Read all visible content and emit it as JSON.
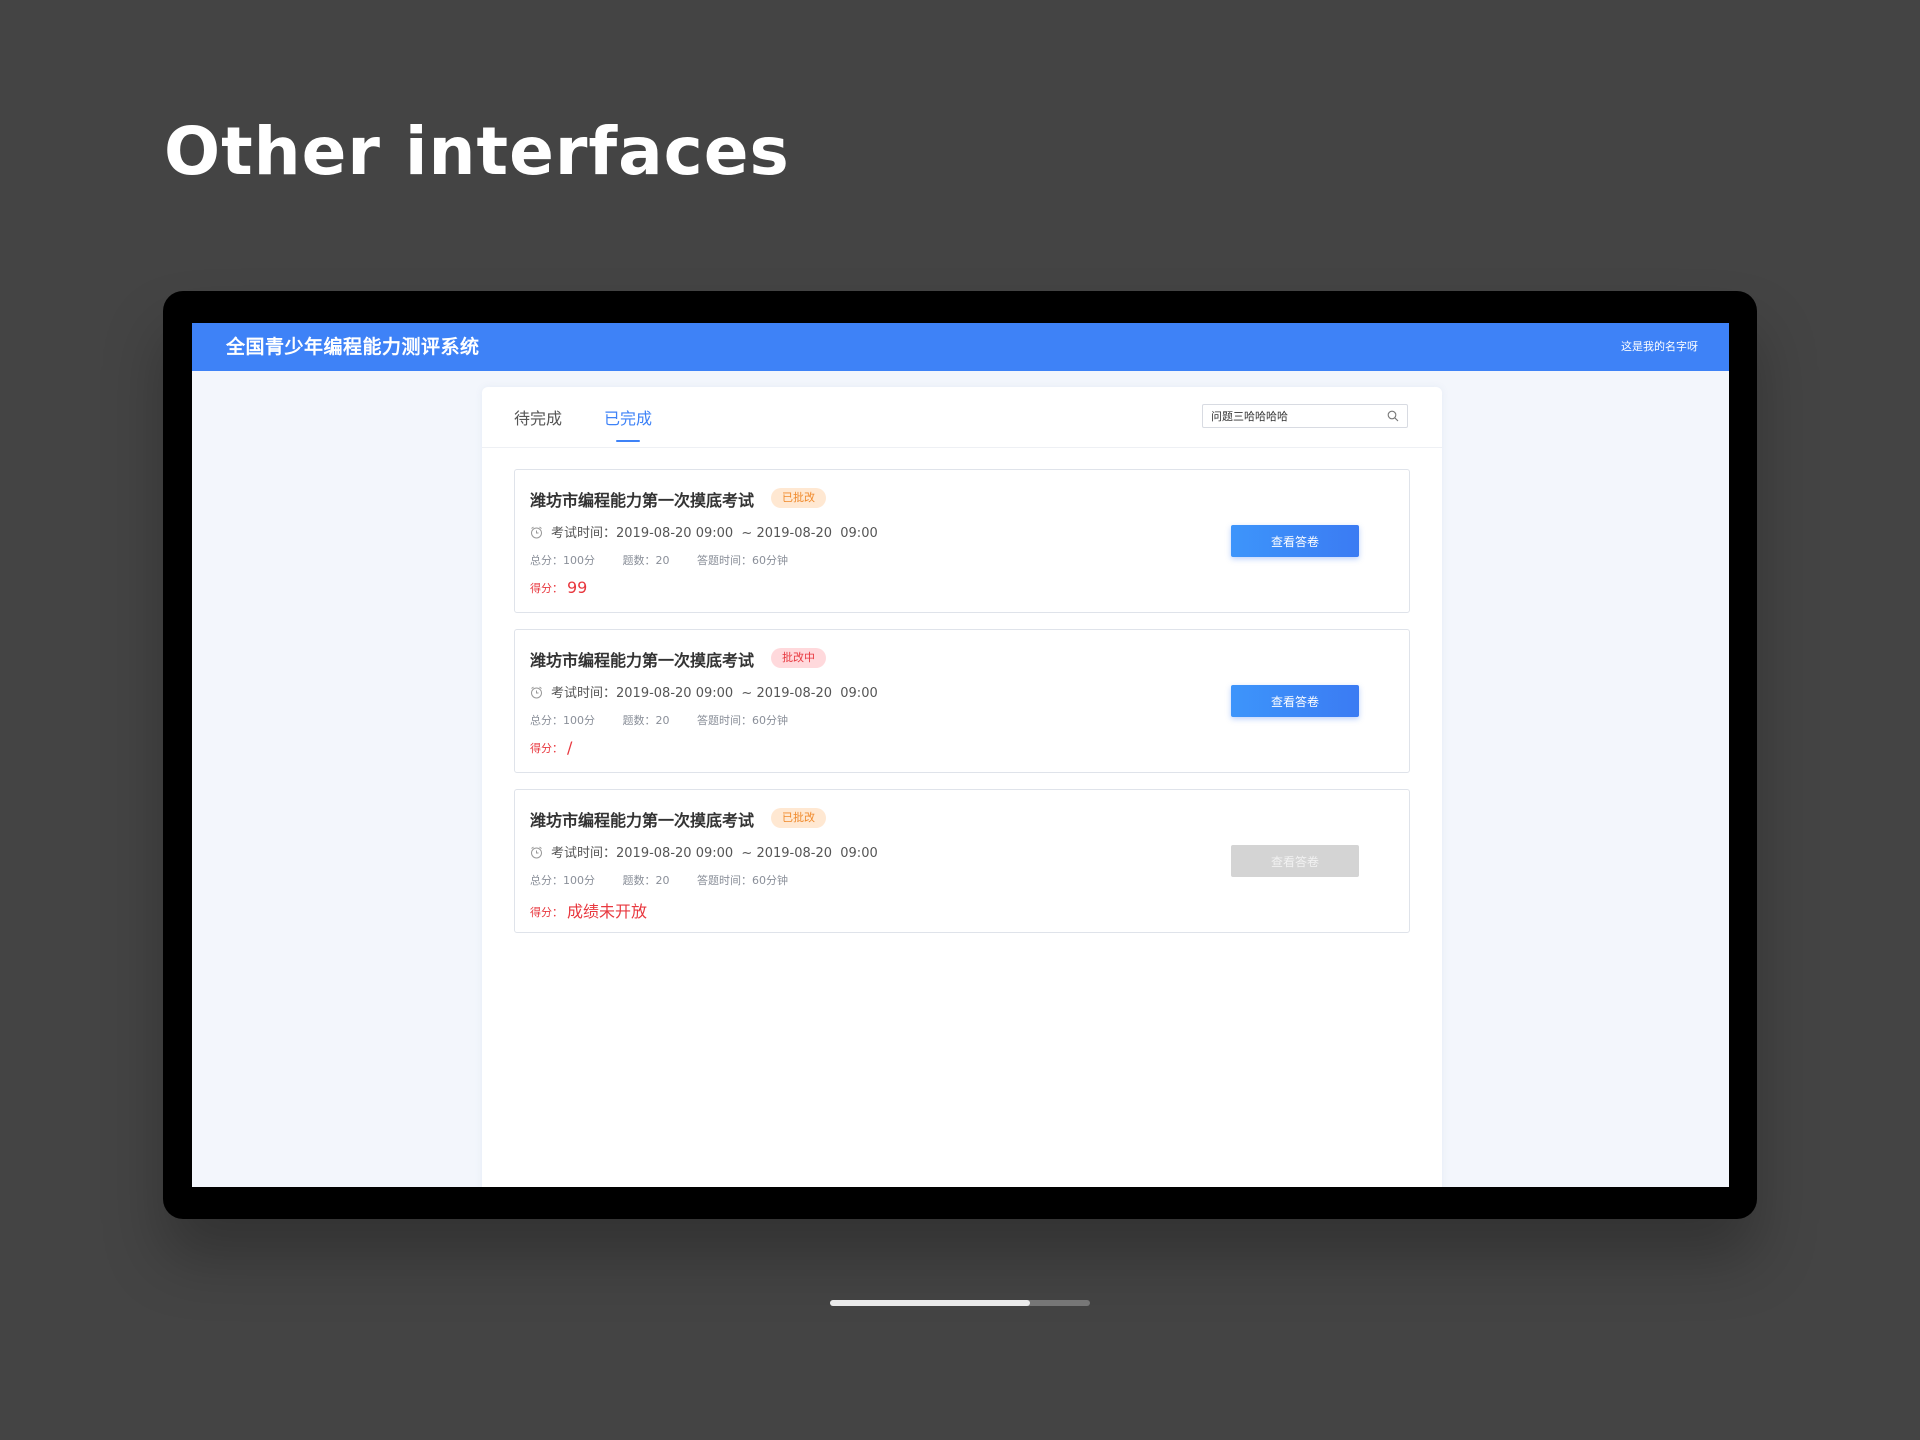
{
  "heading": "Other interfaces",
  "app": {
    "title": "全国青少年编程能力测评系统",
    "user_name": "这是我的名字呀"
  },
  "tabs": [
    {
      "label": "待完成",
      "active": false
    },
    {
      "label": "已完成",
      "active": true
    }
  ],
  "search": {
    "value": "问题三哈哈哈哈",
    "icon": "search-icon"
  },
  "cards": [
    {
      "title": "潍坊市编程能力第一次摸底考试",
      "status": "已批改",
      "time_label": "考试时间：",
      "time_range": "2019-08-20 09:00  ~ 2019-08-20  09:00",
      "total_score": "总分：100分",
      "question_count": "题数：20",
      "duration": "答题时间：60分钟",
      "score_label": "得分：",
      "score_value": "99",
      "button_label": "查看答卷",
      "button_enabled": true
    },
    {
      "title": "潍坊市编程能力第一次摸底考试",
      "status": "批改中",
      "time_label": "考试时间：",
      "time_range": "2019-08-20 09:00  ~ 2019-08-20  09:00",
      "total_score": "总分：100分",
      "question_count": "题数：20",
      "duration": "答题时间：60分钟",
      "score_label": "得分：",
      "score_value": "/",
      "button_label": "查看答卷",
      "button_enabled": true
    },
    {
      "title": "潍坊市编程能力第一次摸底考试",
      "status": "已批改",
      "time_label": "考试时间：",
      "time_range": "2019-08-20 09:00  ~ 2019-08-20  09:00",
      "total_score": "总分：100分",
      "question_count": "题数：20",
      "duration": "答题时间：60分钟",
      "score_label": "得分：",
      "score_value": "成绩未开放",
      "button_label": "查看答卷",
      "button_enabled": false
    }
  ],
  "colors": {
    "primary": "#3e82f7",
    "warning": "#f08a2c",
    "danger": "#e8383f",
    "disabled": "#d4d4d4"
  },
  "page_progress": 0.77
}
